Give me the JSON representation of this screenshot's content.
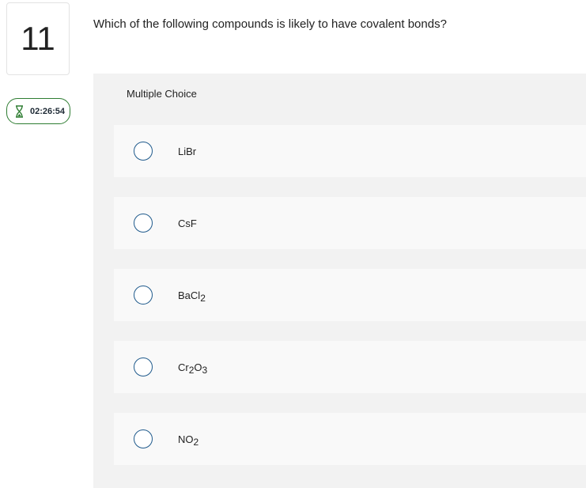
{
  "question_number": "11",
  "timer": {
    "value": "02:26:54",
    "icon": "hourglass-icon",
    "color": "#2e7d32"
  },
  "question_text": "Which of the following compounds is likely to have covalent bonds?",
  "multiple_choice": {
    "header": "Multiple Choice",
    "options": [
      {
        "base": "LiBr",
        "parts": [
          {
            "t": "LiBr"
          }
        ]
      },
      {
        "base": "CsF",
        "parts": [
          {
            "t": "CsF"
          }
        ]
      },
      {
        "base": "BaCl2",
        "parts": [
          {
            "t": "BaCl"
          },
          {
            "sub": "2"
          }
        ]
      },
      {
        "base": "Cr2O3",
        "parts": [
          {
            "t": "Cr"
          },
          {
            "sub": "2"
          },
          {
            "t": "O"
          },
          {
            "sub": "3"
          }
        ]
      },
      {
        "base": "NO2",
        "parts": [
          {
            "t": "NO"
          },
          {
            "sub": "2"
          }
        ]
      }
    ]
  },
  "colors": {
    "radio_border": "#1f5a8c",
    "panel_bg": "#f2f2f2",
    "option_bg": "#f9f9f9"
  }
}
